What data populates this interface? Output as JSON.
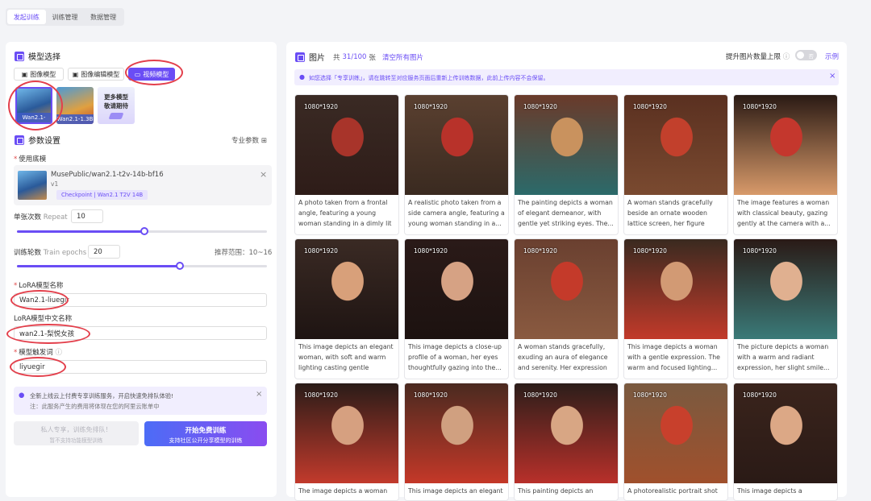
{
  "top_tabs": [
    "发起训练",
    "训练管理",
    "数据管理"
  ],
  "model_select": {
    "title": "模型选择",
    "tabs": [
      "图像模型",
      "图像编辑模型",
      "视频模型"
    ],
    "thumbs": [
      {
        "label": "Wan2.1-14B"
      },
      {
        "label": "Wan2.1-1.3B"
      },
      {
        "label": "更多模型\n敬请期待"
      }
    ]
  },
  "params": {
    "title": "参数设置",
    "pro_label": "专业参数",
    "base_model_label": "使用底模",
    "base_model": {
      "name": "MusePublic/wan2.1-t2v-14b-bf16",
      "version": "v1",
      "tag": "Checkpoint | Wan2.1 T2V 14B"
    },
    "repeat_label": "单张次数",
    "repeat_hint": "Repeat",
    "repeat_value": "10",
    "repeat_fraction": 0.51,
    "epochs_label": "训练轮数",
    "epochs_hint": "Train epochs",
    "epochs_value": "20",
    "epochs_range": "推荐范围：10~16",
    "epochs_fraction": 0.65,
    "lora_name_label": "LoRA模型名称",
    "lora_name_value": "Wan2.1-liuegir",
    "lora_cn_label": "LoRA模型中文名称",
    "lora_cn_value": "wan2.1-梨悦女孩",
    "trigger_label": "模型触发词",
    "trigger_value": "liyuegir",
    "notice_line1": "全新上线云上付费专享训练服务，开启快速免排队体验!",
    "notice_line2": "注：此服务产生的费用将体现在您的阿里云账单中",
    "btn_private_line1": "私人专享，训练免排队！",
    "btn_private_line2": "暂不支持功能模型训练",
    "btn_start_line1": "开始免费训练",
    "btn_start_line2": "支持社区公开分享模型的训练"
  },
  "images": {
    "title": "图片",
    "count_prefix": "共",
    "count": "31/100",
    "count_suffix": "张",
    "clear": "清空所有图片",
    "increase_limit": "提升图片数量上限",
    "toggle": "否",
    "example": "示例",
    "banner": "如您选择「专享训练」，请在跳转至对应服务页面后重新上传训练数据，此前上传内容不会保留。",
    "cards": [
      {
        "res": "1080*1920",
        "desc": "A photo taken from a frontal angle, featuring a young woman standing in a dimly lit indoor..."
      },
      {
        "res": "1080*1920",
        "desc": "A realistic photo taken from a side camera angle, featuring a young woman standing in a..."
      },
      {
        "res": "1080*1920",
        "desc": "The painting depicts a woman of elegant demeanor, with gentle yet striking eyes. The..."
      },
      {
        "res": "1080*1920",
        "desc": "A woman stands gracefully beside an ornate wooden lattice screen, her figure gently..."
      },
      {
        "res": "1080*1920",
        "desc": "The image features a woman with classical beauty, gazing gently at the camera with a..."
      },
      {
        "res": "1080*1920",
        "desc": "This image depicts an elegant woman, with soft and warm lighting casting gentle shadow..."
      },
      {
        "res": "1080*1920",
        "desc": "This image depicts a close-up profile of a woman, her eyes thoughtfully gazing into the..."
      },
      {
        "res": "1080*1920",
        "desc": "A woman stands gracefully, exuding an aura of elegance and serenity. Her expression i..."
      },
      {
        "res": "1080*1920",
        "desc": "This image depicts a woman with a gentle expression. The warm and focused lighting..."
      },
      {
        "res": "1080*1920",
        "desc": "The picture depicts a woman with a warm and radiant expression, her slight smile..."
      },
      {
        "res": "1080*1920",
        "desc": "The image depicts a woman"
      },
      {
        "res": "1080*1920",
        "desc": "This image depicts an elegant"
      },
      {
        "res": "1080*1920",
        "desc": "This painting depicts an elegant"
      },
      {
        "res": "1080*1920",
        "desc": "A photorealistic portrait shot"
      },
      {
        "res": "1080*1920",
        "desc": "This image depicts a"
      }
    ]
  },
  "colors": {
    "accent": "#6a4df5",
    "annotation": "#e33f4b"
  }
}
